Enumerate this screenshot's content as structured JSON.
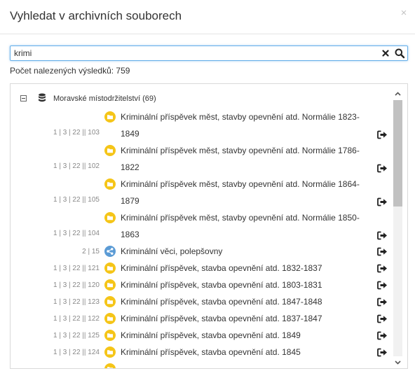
{
  "dialog": {
    "title": "Vyhledat v archivních souborech",
    "close_symbol": "×"
  },
  "search": {
    "value": "krimi",
    "clear_icon": "clear-x-icon",
    "search_icon": "magnifier-icon"
  },
  "results": {
    "count_text": "Počet nalezených výsledků: 759"
  },
  "tree": {
    "group": {
      "label": "Moravské místodržitelství (69)",
      "expanded": true,
      "icon": "database-icon"
    },
    "items": [
      {
        "code": "1 | 3 | 22 || 103",
        "icon": "folder",
        "title": "Kriminální příspěvek měst, stavby opevnění atd. Normálie 1823-1849"
      },
      {
        "code": "1 | 3 | 22 || 102",
        "icon": "folder",
        "title": "Kriminální příspěvek měst, stavby opevnění atd. Normálie 1786-1822"
      },
      {
        "code": "1 | 3 | 22 || 105",
        "icon": "folder",
        "title": "Kriminální příspěvek měst, stavby opevnění atd. Normálie 1864-1879"
      },
      {
        "code": "1 | 3 | 22 || 104",
        "icon": "folder",
        "title": "Kriminální příspěvek měst, stavby opevnění atd. Normálie 1850-1863"
      },
      {
        "code": "2 | 15",
        "icon": "share",
        "title": "Kriminální věci, polepšovny"
      },
      {
        "code": "1 | 3 | 22 || 121",
        "icon": "folder",
        "title": "Kriminální příspěvek, stavba opevnění atd. 1832-1837"
      },
      {
        "code": "1 | 3 | 22 || 120",
        "icon": "folder",
        "title": "Kriminální příspěvek, stavba opevnění atd. 1803-1831"
      },
      {
        "code": "1 | 3 | 22 || 123",
        "icon": "folder",
        "title": "Kriminální příspěvek, stavba opevnění atd. 1847-1848"
      },
      {
        "code": "1 | 3 | 22 || 122",
        "icon": "folder",
        "title": "Kriminální příspěvek, stavba opevnění atd. 1837-1847"
      },
      {
        "code": "1 | 3 | 22 || 125",
        "icon": "folder",
        "title": "Kriminální příspěvek, stavba opevnění atd. 1849"
      },
      {
        "code": "1 | 3 | 22 || 124",
        "icon": "folder",
        "title": "Kriminální příspěvek, stavba opevnění atd. 1845"
      },
      {
        "code": "",
        "icon": "folder",
        "title": ""
      }
    ]
  },
  "colors": {
    "folder": "#f5c518",
    "share": "#5b9bd5",
    "focus_border": "#66afe9",
    "text": "#333333",
    "code_text": "#888888"
  }
}
